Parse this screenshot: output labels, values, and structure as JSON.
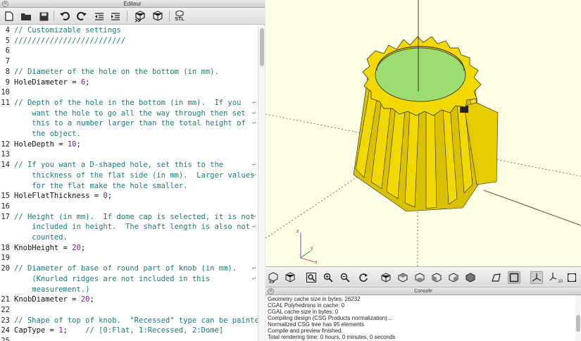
{
  "editor": {
    "title": "Éditeur",
    "toolbar": {
      "stl_label": "STL"
    },
    "lines": [
      {
        "n": "4",
        "parts": [
          {
            "t": "// Customizable settings",
            "c": "cmt"
          }
        ]
      },
      {
        "n": "5",
        "parts": [
          {
            "t": "/////////////////////////",
            "c": "cmt"
          }
        ]
      },
      {
        "n": "6",
        "parts": []
      },
      {
        "n": "7",
        "parts": []
      },
      {
        "n": "8",
        "parts": [
          {
            "t": "// Diameter of the hole on the bottom (in mm).",
            "c": "cmt"
          }
        ]
      },
      {
        "n": "9",
        "parts": [
          {
            "t": "HoleDiameter = ",
            "c": "var"
          },
          {
            "t": "6",
            "c": "num"
          },
          {
            "t": ";",
            "c": "var"
          }
        ]
      },
      {
        "n": "10",
        "parts": []
      },
      {
        "n": "11",
        "parts": [
          {
            "t": "// Depth of the hole in the bottom (in mm).  If you",
            "c": "cmt"
          }
        ],
        "wrap": true
      },
      {
        "n": "",
        "parts": [
          {
            "t": "    want the hole to go all the way through then set",
            "c": "cmt"
          }
        ],
        "wrap": true
      },
      {
        "n": "",
        "parts": [
          {
            "t": "    this to a number larger than the total height of",
            "c": "cmt"
          }
        ],
        "wrap": true
      },
      {
        "n": "",
        "parts": [
          {
            "t": "    the object.",
            "c": "cmt"
          }
        ]
      },
      {
        "n": "12",
        "parts": [
          {
            "t": "HoleDepth = ",
            "c": "var"
          },
          {
            "t": "10",
            "c": "num"
          },
          {
            "t": ";",
            "c": "var"
          }
        ]
      },
      {
        "n": "13",
        "parts": []
      },
      {
        "n": "14",
        "parts": [
          {
            "t": "// If you want a D-shaped hole, set this to the",
            "c": "cmt"
          }
        ],
        "wrap": true
      },
      {
        "n": "",
        "parts": [
          {
            "t": "    thickness of the flat side (in mm).  Larger values",
            "c": "cmt"
          }
        ],
        "wrap": true
      },
      {
        "n": "",
        "parts": [
          {
            "t": "    for the flat make the hole smaller.",
            "c": "cmt"
          }
        ]
      },
      {
        "n": "15",
        "parts": [
          {
            "t": "HoleFlatThickness = ",
            "c": "var"
          },
          {
            "t": "0",
            "c": "num"
          },
          {
            "t": ";",
            "c": "var"
          }
        ]
      },
      {
        "n": "16",
        "parts": []
      },
      {
        "n": "17",
        "parts": [
          {
            "t": "// Height (in mm).  If dome cap is selected, it is not",
            "c": "cmt"
          }
        ],
        "wrap": true
      },
      {
        "n": "",
        "parts": [
          {
            "t": "    included in height.  The shaft length is also not",
            "c": "cmt"
          }
        ],
        "wrap": true
      },
      {
        "n": "",
        "parts": [
          {
            "t": "    counted.",
            "c": "cmt"
          }
        ]
      },
      {
        "n": "18",
        "parts": [
          {
            "t": "KnobHeight = ",
            "c": "var"
          },
          {
            "t": "20",
            "c": "num"
          },
          {
            "t": ";",
            "c": "var"
          }
        ]
      },
      {
        "n": "19",
        "parts": []
      },
      {
        "n": "20",
        "parts": [
          {
            "t": "// Diameter of base of round part of knob (in mm).",
            "c": "cmt"
          }
        ],
        "wrap": true
      },
      {
        "n": "",
        "parts": [
          {
            "t": "    (Knurled ridges are not included in this",
            "c": "cmt"
          }
        ],
        "wrap": true
      },
      {
        "n": "",
        "parts": [
          {
            "t": "    measurement.)",
            "c": "cmt"
          }
        ]
      },
      {
        "n": "21",
        "parts": [
          {
            "t": "KnobDiameter = ",
            "c": "var"
          },
          {
            "t": "20",
            "c": "num"
          },
          {
            "t": ";",
            "c": "var"
          }
        ]
      },
      {
        "n": "22",
        "parts": []
      },
      {
        "n": "23",
        "parts": [
          {
            "t": "// Shape of top of knob.  \"Recessed\" type can be painted.",
            "c": "cmt"
          }
        ]
      },
      {
        "n": "24",
        "parts": [
          {
            "t": "CapType = ",
            "c": "var"
          },
          {
            "t": "1",
            "c": "num"
          },
          {
            "t": ";    ",
            "c": "var"
          },
          {
            "t": "// [0:Flat, 1:Recessed, 2:Dome]",
            "c": "cmt"
          }
        ]
      },
      {
        "n": "25",
        "parts": []
      }
    ]
  },
  "viewport": {
    "axis_labels": {
      "z": "z",
      "y": "y",
      "x": "x"
    },
    "colors": {
      "background": "#ffffe5",
      "model": "#f0d800",
      "model_dark": "#b8a000",
      "hole": "#9ddc70"
    }
  },
  "view_toolbar": {
    "label_10": "10"
  },
  "console": {
    "title": "Console",
    "lines": [
      "Geometry cache size in bytes: 26232",
      "CGAL Polyhedrons in cache: 0",
      "CGAL cache size in bytes: 0",
      "Compiling design (CSG Products normalization)...",
      "Normalized CSG tree has 95 elements",
      "Compile and preview finished.",
      "Total rendering time: 0 hours, 0 minutes, 0 seconds"
    ]
  }
}
